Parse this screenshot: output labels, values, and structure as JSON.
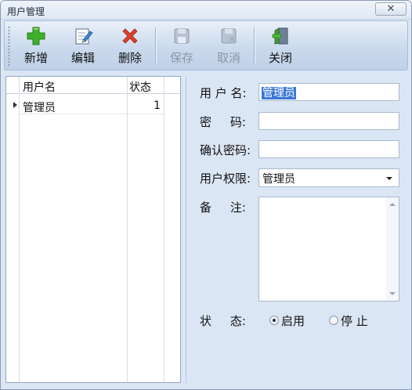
{
  "window": {
    "title": "用户管理",
    "close_glyph": "✕"
  },
  "toolbar": {
    "buttons": [
      {
        "label": "新增",
        "icon": "add-icon",
        "enabled": true
      },
      {
        "label": "编辑",
        "icon": "edit-icon",
        "enabled": true
      },
      {
        "label": "删除",
        "icon": "delete-icon",
        "enabled": true
      },
      {
        "label": "保存",
        "icon": "save-icon",
        "enabled": false
      },
      {
        "label": "取消",
        "icon": "cancel-icon",
        "enabled": false
      },
      {
        "label": "关闭",
        "icon": "exit-icon",
        "enabled": true
      }
    ]
  },
  "grid": {
    "columns": [
      "用户名",
      "状态"
    ],
    "rows": [
      {
        "username": "管理员",
        "status": "1"
      }
    ]
  },
  "form": {
    "username_label": "用 户 名:",
    "username_value": "管理员",
    "password_label": "密     码:",
    "password_value": "",
    "confirm_label": "确认密码:",
    "confirm_value": "",
    "permission_label": "用户权限:",
    "permission_value": "管理员",
    "remark_label": "备     注:",
    "remark_value": "",
    "status_label": "状     态:",
    "status_options": [
      {
        "label": "启用",
        "checked": true
      },
      {
        "label": "停 止",
        "checked": false
      }
    ]
  },
  "colors": {
    "selection": "#3b78d7",
    "panel_bg": "#dbe6f4",
    "add_icon": "#3fae2a",
    "delete_icon": "#d9402b"
  }
}
